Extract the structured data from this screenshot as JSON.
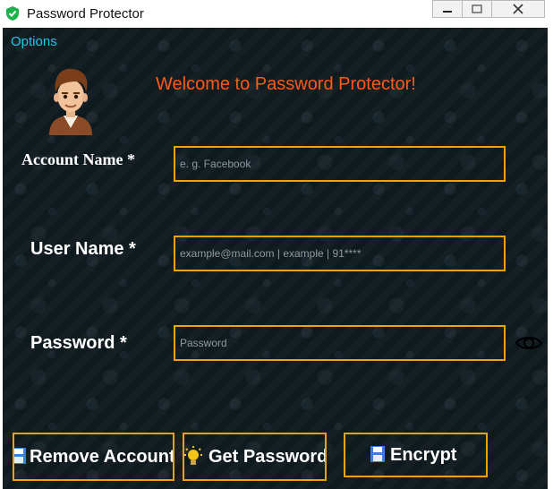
{
  "window": {
    "title": "Password Protector",
    "icon": "shield-check-icon",
    "controls": [
      "minimize-icon",
      "maximize-icon",
      "close-icon"
    ]
  },
  "menu": {
    "options_label": "Options"
  },
  "header": {
    "welcome_text": "Welcome to Password Protector!",
    "avatar": "user-avatar-icon"
  },
  "form": {
    "account_label": "Account Name *",
    "account_placeholder": "e. g. Facebook",
    "account_value": "",
    "user_label": "User Name *",
    "user_placeholder": "example@mail.com | example | 91****",
    "user_value": "",
    "password_label": "Password *",
    "password_placeholder": "Password",
    "password_value": "",
    "show_password_icon": "eye-icon"
  },
  "actions": {
    "remove_label": "Remove Account",
    "remove_icon": "floppy-disk-icon",
    "get_label": "Get Password",
    "get_icon": "lightbulb-icon",
    "encrypt_label": "Encrypt",
    "encrypt_icon": "floppy-disk-icon"
  },
  "colors": {
    "accent_border": "#f0a20f",
    "welcome_text": "#ff5a14",
    "link": "#1fc6e6",
    "background": "#0f1a1f"
  }
}
